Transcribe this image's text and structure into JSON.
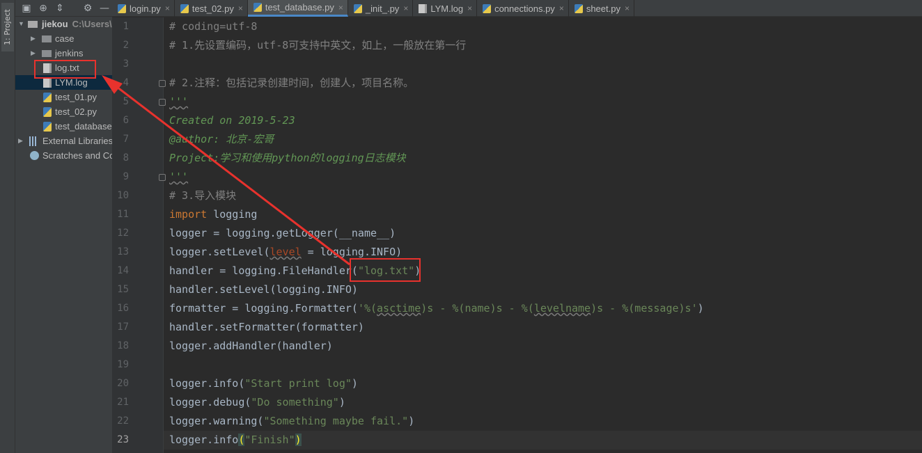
{
  "sidebar": {
    "project_tab": "1: Project",
    "toolbar_icons": [
      "project-view-icon",
      "locate-icon",
      "collapse-icon",
      "settings-icon",
      "hide-icon"
    ],
    "root": {
      "name": "jiekou",
      "path": "C:\\Users\\"
    },
    "items": [
      {
        "label": "case",
        "type": "folder"
      },
      {
        "label": "jenkins",
        "type": "folder"
      },
      {
        "label": "log.txt",
        "type": "txt"
      },
      {
        "label": "LYM.log",
        "type": "txt"
      },
      {
        "label": "test_01.py",
        "type": "py"
      },
      {
        "label": "test_02.py",
        "type": "py"
      },
      {
        "label": "test_database",
        "type": "py"
      }
    ],
    "external_libraries": "External Libraries",
    "scratches": "Scratches and Co"
  },
  "tabs": [
    {
      "label": "login.py",
      "active": false
    },
    {
      "label": "test_02.py",
      "active": false
    },
    {
      "label": "test_database.py",
      "active": true
    },
    {
      "label": "_init_.py",
      "active": false
    },
    {
      "label": "LYM.log",
      "active": false
    },
    {
      "label": "connections.py",
      "active": false
    },
    {
      "label": "sheet.py",
      "active": false
    }
  ],
  "editor": {
    "current_line": 23,
    "lines": [
      {
        "n": "1",
        "t": "# coding=utf-8"
      },
      {
        "n": "2",
        "t": "# 1.先设置编码，utf-8可支持中英文，如上，一般放在第一行"
      },
      {
        "n": "3",
        "t": ""
      },
      {
        "n": "4",
        "t": "# 2.注释：包括记录创建时间，创建人，项目名称。"
      },
      {
        "n": "5",
        "t": "'''"
      },
      {
        "n": "6",
        "t": "Created on 2019-5-23"
      },
      {
        "n": "7",
        "t": "@author: 北京-宏哥"
      },
      {
        "n": "8",
        "t": "Project:学习和使用python的logging日志模块"
      },
      {
        "n": "9",
        "t": "'''"
      },
      {
        "n": "10",
        "t": "# 3.导入模块"
      },
      {
        "n": "11",
        "kw": "import",
        "rest": " logging"
      },
      {
        "n": "12",
        "t": "logger = logging.getLogger(__name__)"
      },
      {
        "n": "13",
        "a": "logger.setLevel(",
        "prm": "level",
        "b": " = logging.INFO)"
      },
      {
        "n": "14",
        "a": "handler = logging.FileHandler(",
        "str": "\"log.txt\"",
        "b": ")"
      },
      {
        "n": "15",
        "t": "handler.setLevel(logging.INFO)"
      },
      {
        "n": "16",
        "a": "formatter = logging.Formatter(",
        "s1": "'%(",
        "w1": "asctime",
        "s2": ")s - %(name)s - %(",
        "w2": "levelname",
        "s3": ")s - %(message)s'",
        "b": ")"
      },
      {
        "n": "17",
        "t": "handler.setFormatter(formatter)"
      },
      {
        "n": "18",
        "t": "logger.addHandler(handler)"
      },
      {
        "n": "19",
        "t": ""
      },
      {
        "n": "20",
        "a": "logger.info(",
        "str": "\"Start print log\"",
        "b": ")"
      },
      {
        "n": "21",
        "a": "logger.debug(",
        "str": "\"Do something\"",
        "b": ")"
      },
      {
        "n": "22",
        "a": "logger.warning(",
        "str": "\"Something maybe fail.\"",
        "b": ")"
      },
      {
        "n": "23",
        "a": "logger.info",
        "bo": "(",
        "str": "\"Finish\"",
        "bc": ")"
      }
    ]
  },
  "colors": {
    "annotation_red": "#e8322d",
    "comment": "#808080",
    "docstring": "#629755",
    "keyword": "#cc7832",
    "string": "#6a8759",
    "param": "#aa4926"
  }
}
